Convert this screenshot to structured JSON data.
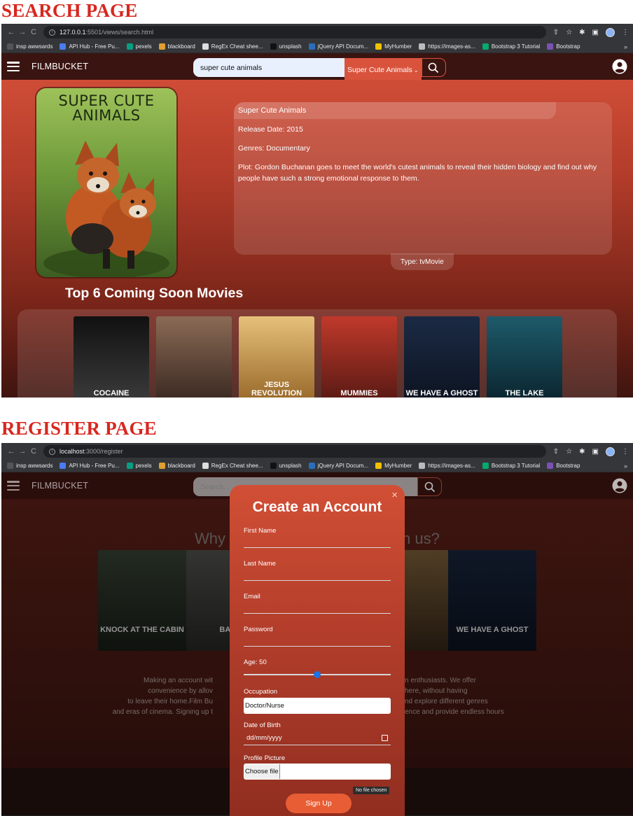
{
  "search_page": {
    "heading": "SEARCH PAGE",
    "browser": {
      "url_host": "127.0.0.1",
      "url_path": ":5501/views/search.html"
    },
    "nav": {
      "brand": "FILMBUCKET",
      "search_value": "super cute animals",
      "select_value": "Super Cute Animals"
    },
    "poster_title": "SUPER CUTE\nANIMALS",
    "movie": {
      "title": "Super Cute Animals",
      "release": "Release Date: 2015",
      "genres": "Genres: Documentary",
      "plot": "Plot: Gordon Buchanan goes to meet the world's cutest animals to reveal their hidden biology and find out why people have such a strong emotional response to them.",
      "type": "Type: tvMovie"
    },
    "coming_title": "Top 6 Coming Soon Movies",
    "coming_posters": [
      {
        "caption": "COCAINE",
        "colors": [
          "#111111",
          "#3a3a3a"
        ]
      },
      {
        "caption": "",
        "colors": [
          "#8a6a55",
          "#3b2a22"
        ]
      },
      {
        "caption": "JESUS REVOLUTION",
        "colors": [
          "#e6c07a",
          "#9a6a2a"
        ]
      },
      {
        "caption": "MUMMIES",
        "colors": [
          "#c0392b",
          "#5a1a14"
        ]
      },
      {
        "caption": "WE HAVE A GHOST",
        "colors": [
          "#1b2a44",
          "#0d1422"
        ]
      },
      {
        "caption": "THE LAKE",
        "colors": [
          "#1e5a6a",
          "#0b2630"
        ]
      }
    ]
  },
  "register_page": {
    "heading": "REGISTER PAGE",
    "browser": {
      "url_host": "localhost",
      "url_path": ":3000/register"
    },
    "nav": {
      "brand": "FILMBUCKET",
      "search_placeholder": "Search..."
    },
    "why_left": "Why",
    "why_right": "n us?",
    "body_left": [
      "Making an account wit",
      "convenience by allov",
      "to leave their home.Film Bu",
      "and eras of cinema. Signing up t"
    ],
    "body_right": [
      "n enthusiasts. We offer",
      "here, without having",
      "nd explore different genres",
      "ence and provide endless hours"
    ],
    "reg_posters": [
      {
        "caption": "KNOCK AT THE CABIN",
        "colors": [
          "#3d4a3a",
          "#1a2018"
        ]
      },
      {
        "caption": "BANS",
        "colors": [
          "#5a5a55",
          "#2a2a28"
        ]
      },
      {
        "caption": "",
        "colors": [
          "#8a6a40",
          "#3a2a1a"
        ]
      },
      {
        "caption": "WE HAVE A GHOST",
        "colors": [
          "#1b2a44",
          "#0d1422"
        ]
      }
    ],
    "modal": {
      "title": "Create an Account",
      "close": "×",
      "first_name": "First Name",
      "last_name": "Last Name",
      "email": "Email",
      "password": "Password",
      "age_label": "Age: 50",
      "age_value": 50,
      "occupation_label": "Occupation",
      "occupation_value": "Doctor/Nurse",
      "dob_label": "Date of Birth",
      "dob_placeholder": "dd/mm/yyyy",
      "picture_label": "Profile Picture",
      "choose_file": "Choose file",
      "no_file": "No file chosen",
      "signup": "Sign Up"
    }
  },
  "bookmarks": [
    {
      "label": "insp awwsards",
      "color": "#555555"
    },
    {
      "label": "API Hub - Free Pu...",
      "color": "#4a7cf0"
    },
    {
      "label": "pexels",
      "color": "#05a081"
    },
    {
      "label": "blackboard",
      "color": "#e0a030"
    },
    {
      "label": "RegEx Cheat shee...",
      "color": "#dddddd"
    },
    {
      "label": "unsplash",
      "color": "#111111"
    },
    {
      "label": "jQuery API Docum...",
      "color": "#2a6ebb"
    },
    {
      "label": "MyHumber",
      "color": "#f2c200"
    },
    {
      "label": "https://images-as...",
      "color": "#bbbbbb"
    },
    {
      "label": "Bootstrap 3 Tutorial",
      "color": "#04aa6d"
    },
    {
      "label": "Bootstrap",
      "color": "#7952b3"
    }
  ],
  "bookmarks_more": "»"
}
